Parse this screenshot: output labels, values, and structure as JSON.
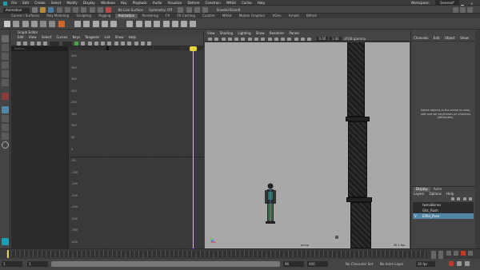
{
  "menubar": {
    "items": [
      "File",
      "Edit",
      "Create",
      "Select",
      "Modify",
      "Display",
      "Windows",
      "Key",
      "Playback",
      "Audio",
      "Visualize",
      "Deform",
      "Constrain",
      "MASH",
      "Cache",
      "Help"
    ],
    "workspace_label": "Workspace:",
    "workspace_value": "General*"
  },
  "statusline": {
    "mode": "Animation",
    "live_surface": "No Live Surface",
    "symmetry": "Symmetry: Off",
    "login": "Sheetal Brandt"
  },
  "shelf": {
    "tabs": [
      "Curves / Surfaces",
      "Poly Modeling",
      "Sculpting",
      "Rigging",
      "Animation",
      "Rendering",
      "FX",
      "FX Caching",
      "Custom",
      "MASH",
      "Motion Graphics",
      "XGen",
      "Arnold",
      "Bifrost"
    ],
    "active_index": 4
  },
  "graph_editor": {
    "title": "Graph Editor",
    "menus": [
      "Edit",
      "View",
      "Select",
      "Curves",
      "Keys",
      "Tangents",
      "List",
      "Show",
      "Help"
    ],
    "search_placeholder": "Search...",
    "y_labels": [
      "400",
      "350",
      "300",
      "250",
      "200",
      "150",
      "100",
      "50",
      "0",
      "-50",
      "-100",
      "-150",
      "-200",
      "-250",
      "-300",
      "-350",
      "-400"
    ]
  },
  "viewport": {
    "menus": [
      "View",
      "Shading",
      "Lighting",
      "Show",
      "Renderer",
      "Panels"
    ],
    "gamma": "sRGB gamma",
    "value1": "0.00",
    "value2": "1.00",
    "camera_label": "persp",
    "fps": "30.1 fps"
  },
  "channel_box": {
    "menus": [
      "Channels",
      "Edit",
      "Object",
      "Show"
    ],
    "hint": "Select objects in the scene to view, edit and set keyframes on channels (attributes)."
  },
  "layer_editor": {
    "tabs": [
      "Display",
      "Anim"
    ],
    "active_tab": "Display",
    "menus": [
      "Layers",
      "Options",
      "Help"
    ],
    "layers": [
      {
        "name": "twinaBones",
        "selected": false
      },
      {
        "name": "Gitc_Rush",
        "selected": false
      },
      {
        "name": "Eiffel_Pose",
        "selected": true
      }
    ]
  },
  "timeline": {
    "start": "1",
    "range_start": "1",
    "range_end": "96",
    "end": "400",
    "current_frame": "1",
    "character_set": "No Character Set",
    "anim_layer": "No Anim Layer",
    "fps": "30 fps"
  },
  "colors": {
    "accent": "#5285a6",
    "playhead": "#e6d23a",
    "viewport_bg": "#a8a8a8"
  }
}
